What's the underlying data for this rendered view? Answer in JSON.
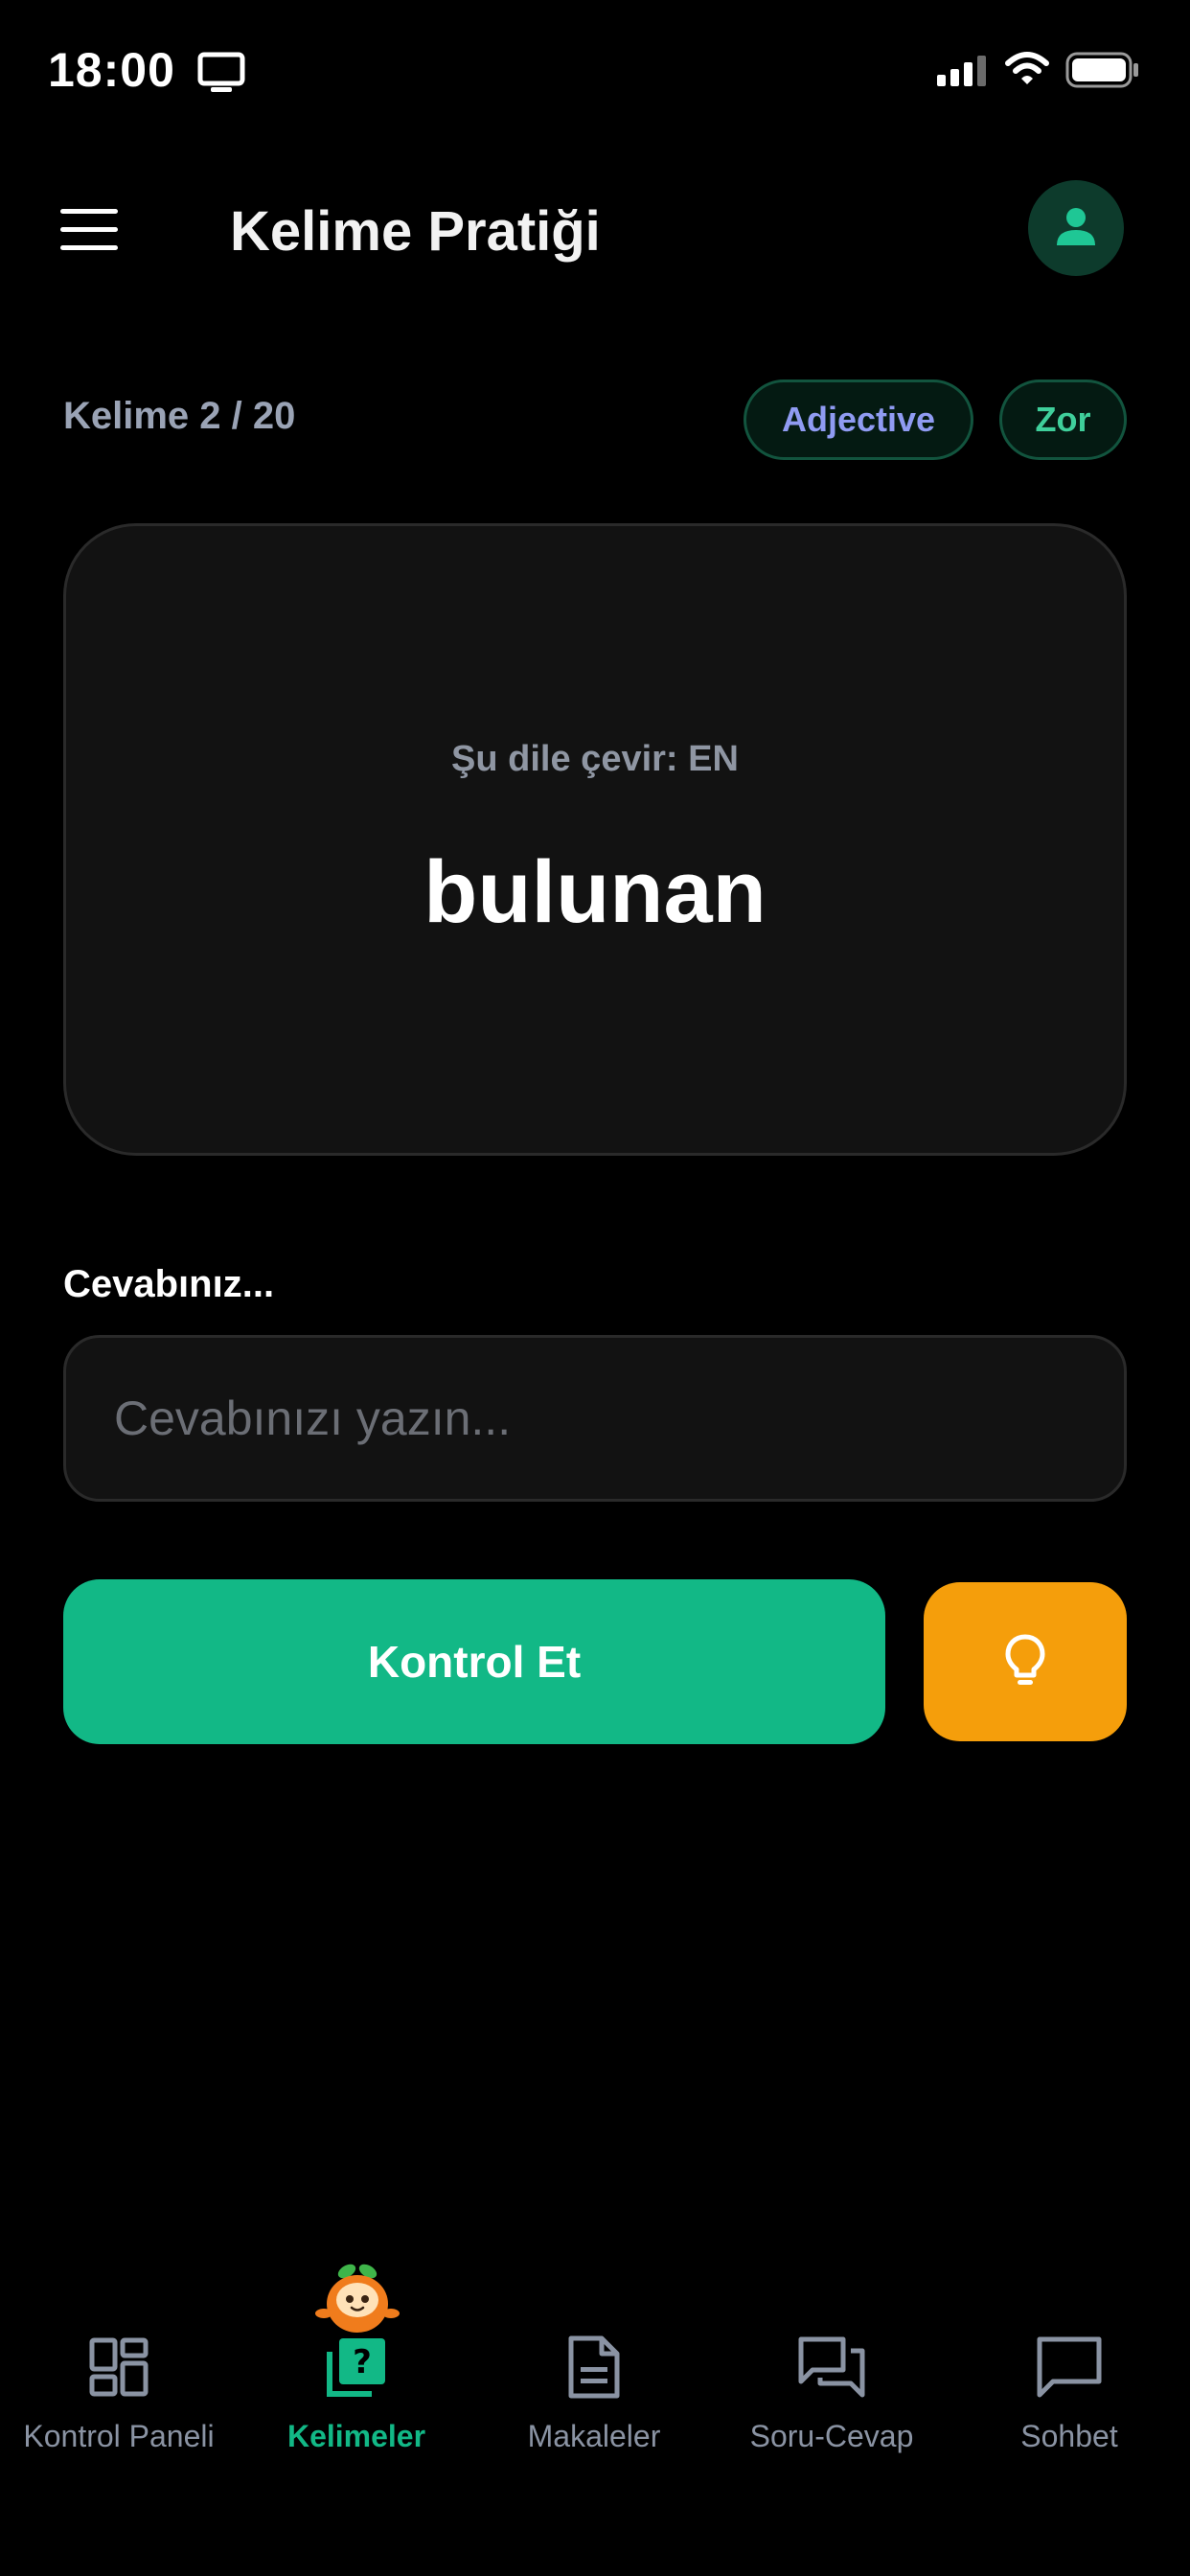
{
  "status_bar": {
    "time": "18:00",
    "icons": [
      "monitor-icon",
      "cellular-signal-icon",
      "wifi-icon",
      "battery-icon"
    ]
  },
  "header": {
    "title": "Kelime Pratiği",
    "menu_icon": "hamburger-menu-icon",
    "profile_icon": "person-icon"
  },
  "practice": {
    "counter": "Kelime 2 / 20",
    "badges": {
      "type": "Adjective",
      "level": "Zor"
    }
  },
  "card": {
    "instruction": "Şu dile çevir: EN",
    "word": "bulunan"
  },
  "answer": {
    "label": "Cevabınız...",
    "value": "",
    "placeholder": "Cevabınızı yazın..."
  },
  "actions": {
    "check_label": "Kontrol Et",
    "hint_icon": "lightbulb-icon"
  },
  "nav": {
    "items": [
      {
        "label": "Kontrol Paneli",
        "icon": "dashboard-icon",
        "active": false
      },
      {
        "label": "Kelimeler",
        "icon": "vocabulary-quiz-icon",
        "active": true
      },
      {
        "label": "Makaleler",
        "icon": "document-icon",
        "active": false
      },
      {
        "label": "Soru-Cevap",
        "icon": "forum-icon",
        "active": false
      },
      {
        "label": "Sohbet",
        "icon": "chat-icon",
        "active": false
      }
    ]
  },
  "colors": {
    "background": "#000000",
    "accent": "#12b886",
    "hint": "#f59e0b",
    "card": "#121212",
    "badge_type_text": "#8f9bf2",
    "badge_level_text": "#3fcf9b",
    "muted_text": "#8a93a3"
  }
}
